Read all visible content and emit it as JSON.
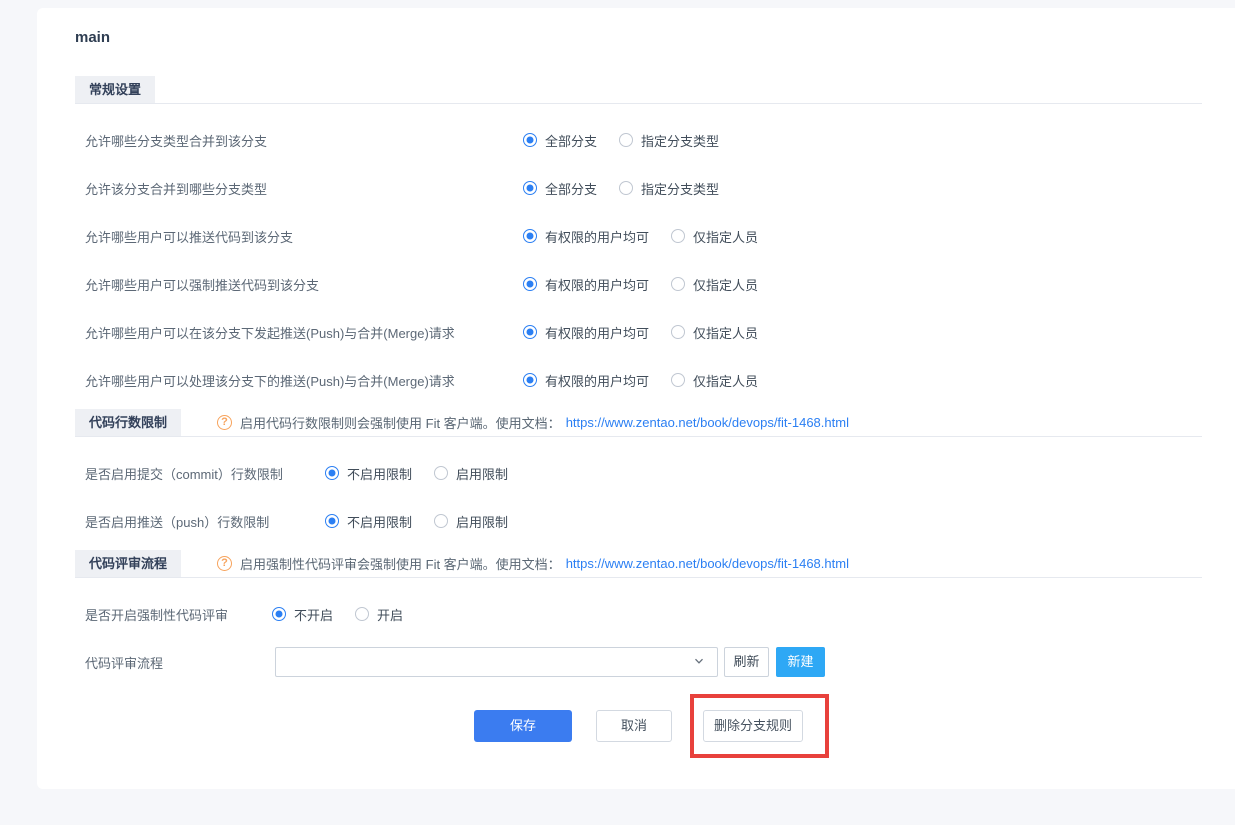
{
  "page": {
    "title": "main"
  },
  "sections": [
    {
      "tab": "常规设置",
      "rows": [
        {
          "label": "允许哪些分支类型合并到该分支",
          "options": [
            {
              "label": "全部分支",
              "selected": true
            },
            {
              "label": "指定分支类型",
              "selected": false
            }
          ]
        },
        {
          "label": "允许该分支合并到哪些分支类型",
          "options": [
            {
              "label": "全部分支",
              "selected": true
            },
            {
              "label": "指定分支类型",
              "selected": false
            }
          ]
        },
        {
          "label": "允许哪些用户可以推送代码到该分支",
          "options": [
            {
              "label": "有权限的用户均可",
              "selected": true
            },
            {
              "label": "仅指定人员",
              "selected": false
            }
          ]
        },
        {
          "label": "允许哪些用户可以强制推送代码到该分支",
          "options": [
            {
              "label": "有权限的用户均可",
              "selected": true
            },
            {
              "label": "仅指定人员",
              "selected": false
            }
          ]
        },
        {
          "label": "允许哪些用户可以在该分支下发起推送(Push)与合并(Merge)请求",
          "options": [
            {
              "label": "有权限的用户均可",
              "selected": true
            },
            {
              "label": "仅指定人员",
              "selected": false
            }
          ]
        },
        {
          "label": "允许哪些用户可以处理该分支下的推送(Push)与合并(Merge)请求",
          "options": [
            {
              "label": "有权限的用户均可",
              "selected": true
            },
            {
              "label": "仅指定人员",
              "selected": false
            }
          ]
        }
      ]
    },
    {
      "tab": "代码行数限制",
      "hint_icon": "?",
      "hint_text": "启用代码行数限制则会强制使用 Fit 客户端。使用文档：",
      "hint_link": "https://www.zentao.net/book/devops/fit-1468.html",
      "rows": [
        {
          "label": "是否启用提交（commit）行数限制",
          "options": [
            {
              "label": "不启用限制",
              "selected": true
            },
            {
              "label": "启用限制",
              "selected": false
            }
          ]
        },
        {
          "label": "是否启用推送（push）行数限制",
          "options": [
            {
              "label": "不启用限制",
              "selected": true
            },
            {
              "label": "启用限制",
              "selected": false
            }
          ]
        }
      ]
    },
    {
      "tab": "代码评审流程",
      "hint_icon": "?",
      "hint_text": "启用强制性代码评审会强制使用 Fit 客户端。使用文档：",
      "hint_link": "https://www.zentao.net/book/devops/fit-1468.html",
      "rows": [
        {
          "label": "是否开启强制性代码评审",
          "options": [
            {
              "label": "不开启",
              "selected": true
            },
            {
              "label": "开启",
              "selected": false
            }
          ]
        }
      ],
      "workflow": {
        "label": "代码评审流程",
        "select_value": "",
        "refresh_label": "刷新",
        "create_label": "新建"
      }
    }
  ],
  "footer": {
    "save_label": "保存",
    "cancel_label": "取消",
    "delete_label": "删除分支规则"
  },
  "colors": {
    "primary_blue": "#3b7cf0",
    "radio_blue": "#2b7ff3",
    "sky_blue": "#2ea8f5",
    "link_blue": "#2b7ff3",
    "annotation_red": "#e8413c",
    "hint_orange": "#f7a35c"
  }
}
